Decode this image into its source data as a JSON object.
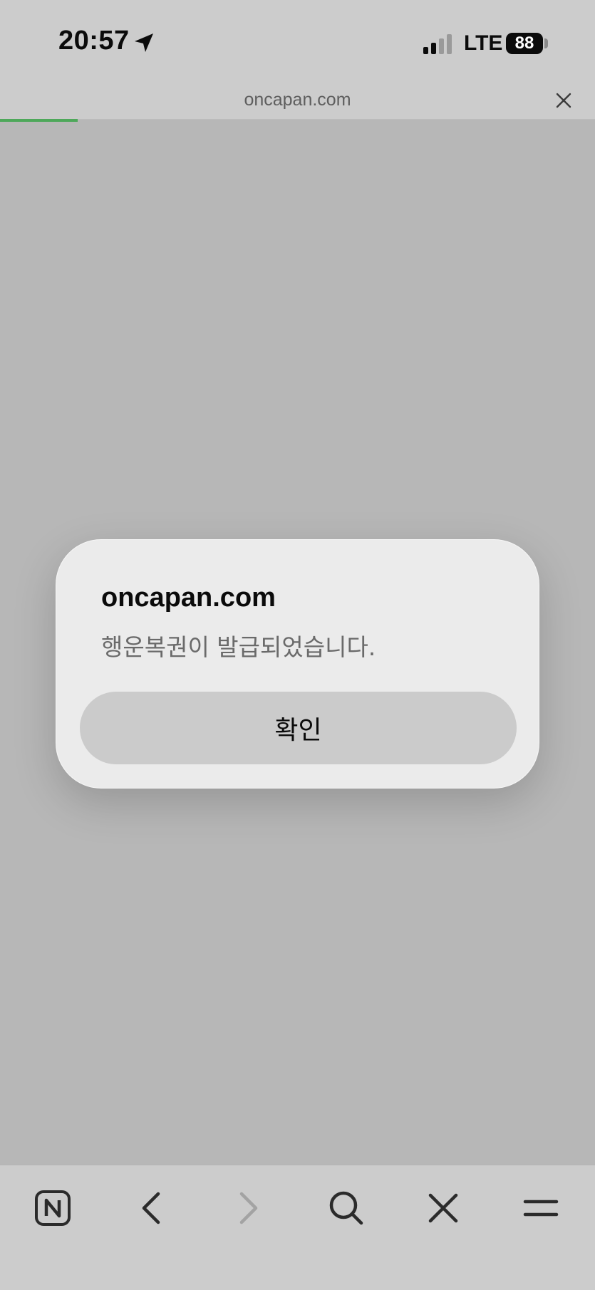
{
  "status_bar": {
    "time": "20:57",
    "network": "LTE",
    "battery": "88",
    "icons": [
      "location-arrow-icon",
      "signal-bars-icon",
      "battery-icon"
    ]
  },
  "address_bar": {
    "url": "oncapan.com",
    "close_icon": "close-icon",
    "load_progress": 0.13,
    "progress_color": "#4ea85a"
  },
  "dialog": {
    "title": "oncapan.com",
    "message": "행운복권이 발급되었습니다.",
    "confirm_label": "확인"
  },
  "toolbar": {
    "items": [
      {
        "icon": "naver-n-icon",
        "enabled": true
      },
      {
        "icon": "back-arrow-icon",
        "enabled": true
      },
      {
        "icon": "forward-arrow-icon",
        "enabled": false
      },
      {
        "icon": "search-icon",
        "enabled": true
      },
      {
        "icon": "close-icon",
        "enabled": true
      },
      {
        "icon": "menu-icon",
        "enabled": true
      }
    ]
  }
}
